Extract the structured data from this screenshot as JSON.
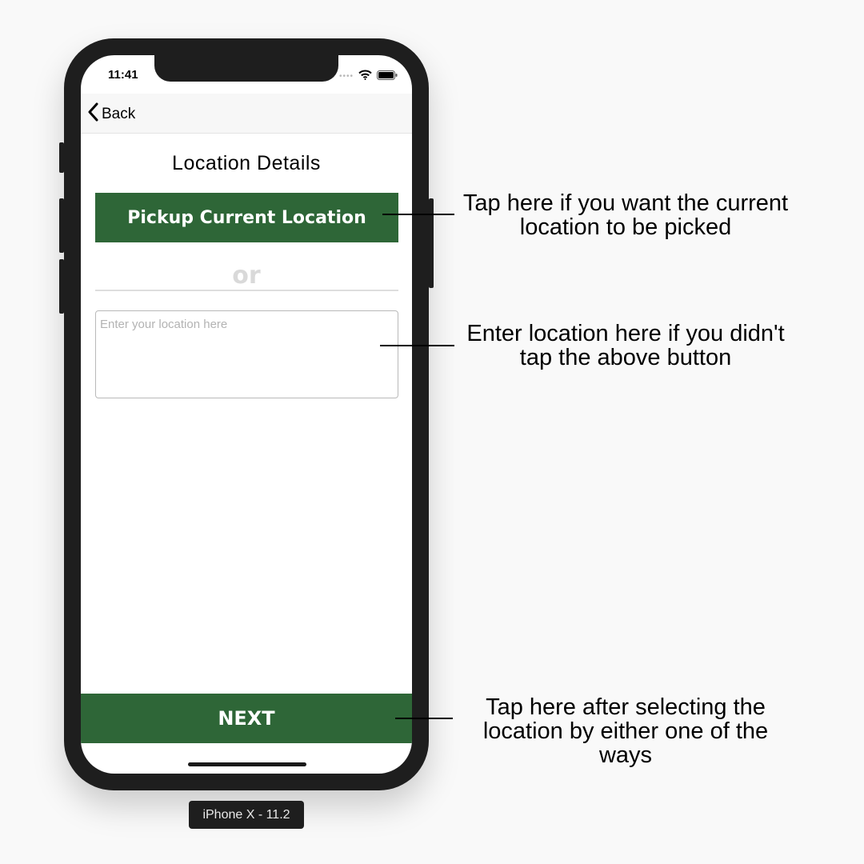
{
  "status_bar": {
    "time": "11:41",
    "signal_dots": "••••"
  },
  "nav": {
    "back_label": "Back"
  },
  "screen": {
    "title": "Location Details",
    "pickup_button_label": "Pickup Current Location",
    "separator_text": "or",
    "location_input": {
      "placeholder": "Enter your location here",
      "value": ""
    },
    "next_button_label": "NEXT"
  },
  "device_label": "iPhone X - 11.2",
  "annotations": {
    "pickup": {
      "line1": "Tap here if you want the current",
      "line2": "location to be picked"
    },
    "input": {
      "line1": "Enter location here if you didn't",
      "line2": "tap the above button"
    },
    "next": {
      "line1": "Tap here after selecting the",
      "line2": "location by either one of the",
      "line3": "ways"
    }
  },
  "colors": {
    "primary_green": "#2e6637",
    "phone_frame": "#1e1e1e",
    "separator_gray": "#d9d9d9"
  },
  "icons": [
    "chevron-left-icon",
    "wifi-icon",
    "battery-icon"
  ]
}
